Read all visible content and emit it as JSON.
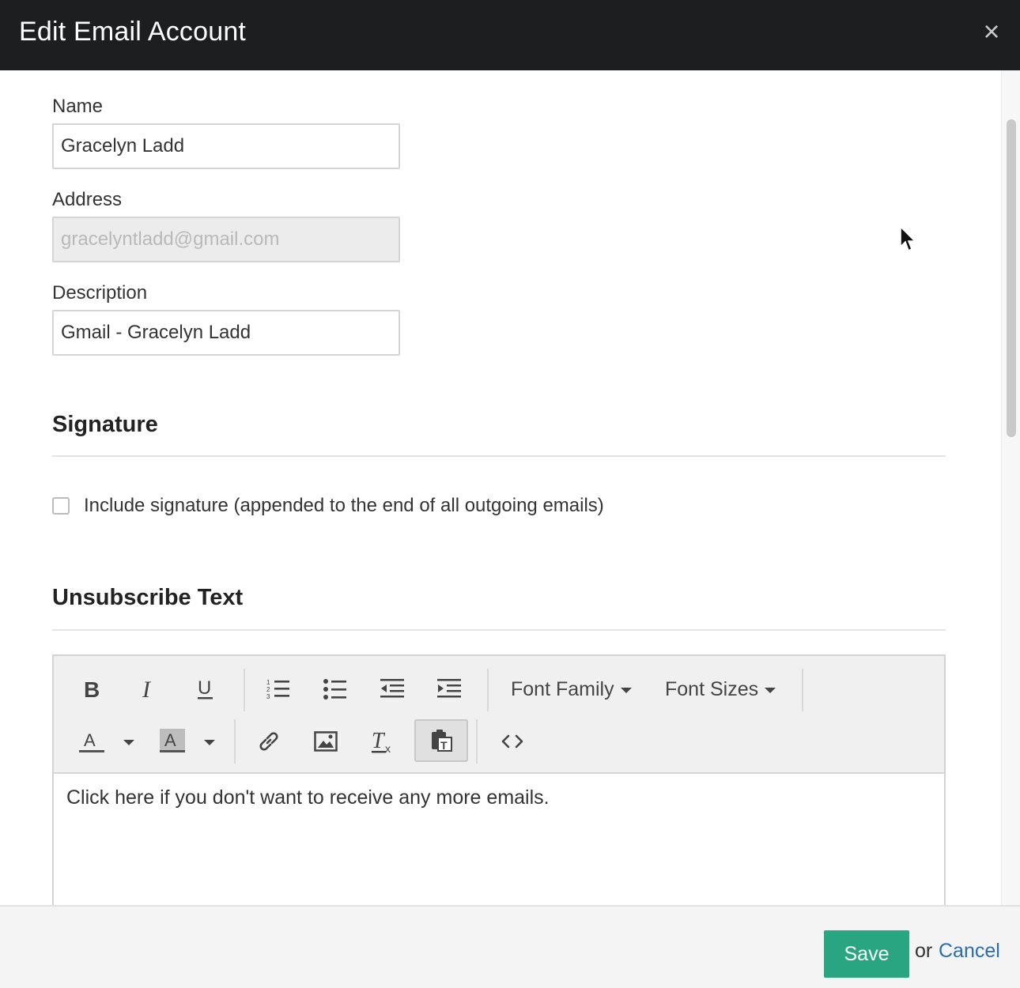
{
  "header": {
    "title": "Edit Email Account",
    "close_icon": "close-icon"
  },
  "form": {
    "name": {
      "label": "Name",
      "value": "Gracelyn Ladd"
    },
    "address": {
      "label": "Address",
      "value": "gracelyntladd@gmail.com"
    },
    "description": {
      "label": "Description",
      "value": "Gmail - Gracelyn Ladd"
    }
  },
  "signature": {
    "title": "Signature",
    "checkbox_label": "Include signature (appended to the end of all outgoing emails)",
    "checked": false
  },
  "unsubscribe": {
    "title": "Unsubscribe Text",
    "toolbar": {
      "font_family_label": "Font Family",
      "font_sizes_label": "Font Sizes",
      "icons": [
        "bold-icon",
        "italic-icon",
        "underline-icon",
        "ordered-list-icon",
        "bullet-list-icon",
        "outdent-icon",
        "indent-icon",
        "text-color-icon",
        "background-color-icon",
        "link-icon",
        "image-icon",
        "clear-format-icon",
        "paste-text-icon",
        "source-code-icon"
      ]
    },
    "body_text": "Click here if you don't want to receive any more emails."
  },
  "footer": {
    "save_label": "Save",
    "or_text": "or",
    "cancel_label": "Cancel"
  },
  "colors": {
    "header_bg": "#1d1e20",
    "save_bg": "#2aa582",
    "link": "#2a6db0"
  }
}
